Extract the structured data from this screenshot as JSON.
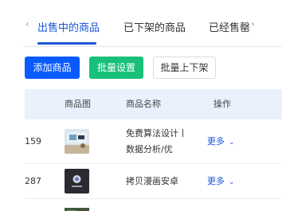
{
  "tabs": {
    "items": [
      {
        "label": "出售中的商品",
        "active": true
      },
      {
        "label": "已下架的商品",
        "active": false
      },
      {
        "label": "已经售罄",
        "active": false
      }
    ]
  },
  "toolbar": {
    "add_label": "添加商品",
    "batch_settings_label": "批量设置",
    "batch_shelf_label": "批量上下架"
  },
  "table": {
    "headers": {
      "image": "商品图",
      "name": "商品名称",
      "action": "操作"
    },
    "rows": [
      {
        "id": "159",
        "name_line1": "免费算法设计丨二",
        "name_line2": "数据分析/优",
        "more": "更多"
      },
      {
        "id": "287",
        "name_line1": "拷贝漫画安卓",
        "name_line2": "",
        "more": "更多"
      },
      {
        "id": "",
        "name_line1": "",
        "name_line2": "",
        "more": ""
      }
    ]
  },
  "colors": {
    "accent": "#1a56db",
    "primary_button": "#0a5bff",
    "green_button": "#19c07a",
    "header_bg": "#e8f1fc"
  }
}
